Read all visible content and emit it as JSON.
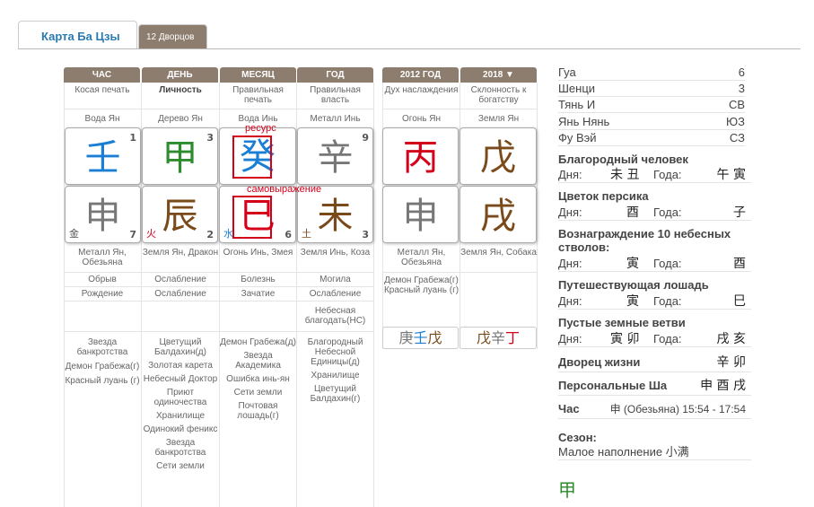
{
  "tabs": {
    "active": "Карта Ба Цзы",
    "other": "12 Дворцов"
  },
  "headers": [
    "ЧАС",
    "ДЕНЬ",
    "МЕСЯЦ",
    "ГОД",
    "2012 ГОД",
    "2018 ▼"
  ],
  "row1": [
    "Косая печать",
    "Личность",
    "Правильная печать",
    "Правильная власть",
    "Дух наслаждения",
    "Склонность к богатству"
  ],
  "row2": [
    "Вода Ян",
    "Дерево Ян",
    "Вода Инь",
    "Металл Инь",
    "Огонь Ян",
    "Земля Ян"
  ],
  "stems": [
    {
      "char": "壬",
      "color": "#1a7fd4",
      "num": "1"
    },
    {
      "char": "甲",
      "color": "#2e8b2e",
      "num": "3"
    },
    {
      "char": "癸",
      "color": "#1a7fd4",
      "num": ""
    },
    {
      "char": "辛",
      "color": "#777777",
      "num": "9"
    },
    {
      "char": "丙",
      "color": "#d4001a",
      "num": ""
    },
    {
      "char": "戊",
      "color": "#7a4a1a",
      "num": ""
    }
  ],
  "branches": [
    {
      "char": "申",
      "color": "#777777",
      "el": "金",
      "elcolor": "#555555",
      "num": "7"
    },
    {
      "char": "辰",
      "color": "#7a4a1a",
      "el": "火",
      "elcolor": "#d4001a",
      "num": "2"
    },
    {
      "char": "巳",
      "color": "#d4001a",
      "el": "水",
      "elcolor": "#1a7fd4",
      "num": "6"
    },
    {
      "char": "未",
      "color": "#7a4a1a",
      "el": "土",
      "elcolor": "#7a4a1a",
      "num": "3"
    },
    {
      "char": "申",
      "color": "#777777",
      "el": "",
      "elcolor": "#555555",
      "num": ""
    },
    {
      "char": "戌",
      "color": "#7a4a1a",
      "el": "",
      "elcolor": "#555555",
      "num": ""
    }
  ],
  "annot": {
    "resource": "ресурс",
    "self": "самовыражение"
  },
  "row3": [
    "Металл Ян, Обезьяна",
    "Земля Ян, Дракон",
    "Огонь Инь, Змея",
    "Земля Инь, Коза",
    "Металл Ян, Обезьяна",
    "Земля Ян, Собака"
  ],
  "row4": [
    "Обрыв",
    "Ослабление",
    "Болезнь",
    "Могила"
  ],
  "row5": [
    "Рождение",
    "Ослабление",
    "Зачатие",
    "Ослабление"
  ],
  "row6_year": "Небесная благодать(НС)",
  "luck_stars": "Демон Грабежа(г) Красный луань (г)",
  "hidden1": {
    "a": "庚",
    "b": "壬",
    "c": "戊"
  },
  "hidden2": {
    "a": "戊",
    "b": "辛",
    "c": "丁"
  },
  "stars_hour": [
    "Звезда банкротства",
    "Демон Грабежа(г)",
    "Красный луань (г)"
  ],
  "stars_day": [
    "Цветущий Балдахин(д)",
    "Золотая карета",
    "Небесный Доктор",
    "Приют одиночества",
    "Хранилище",
    "Одинокий феникс",
    "Звезда банкротства",
    "Сети земли"
  ],
  "stars_month": [
    "Демон Грабежа(д)",
    "Звезда Академика",
    "Ошибка инь-ян",
    "Сети земли",
    "Почтовая лошадь(г)"
  ],
  "stars_year": [
    "Благородный Небесной Единицы(д)",
    "Хранилище",
    "Цветущий Балдахин(г)"
  ],
  "right": {
    "gua_l": "Гуа",
    "gua_v": "6",
    "shenci_l": "Шенци",
    "shenci_v": "3",
    "tian_l": "Тянь И",
    "tian_v": "СВ",
    "yan_l": "Янь Нянь",
    "yan_v": "ЮЗ",
    "fu_l": "Фу Вэй",
    "fu_v": "СЗ",
    "noble": "Благородный человек",
    "noble_d": "未 丑",
    "noble_y": "午 寅",
    "peach": "Цветок персика",
    "peach_d": "酉",
    "peach_y": "子",
    "reward": "Вознаграждение 10 небесных стволов:",
    "reward_d": "寅",
    "reward_y": "酉",
    "horse": "Путешествующая лошадь",
    "horse_d": "寅",
    "horse_y": "巳",
    "empty": "Пустые земные ветви",
    "empty_d": "寅 卯",
    "empty_y": "戌 亥",
    "palace": "Дворец жизни",
    "palace_v": "辛 卯",
    "sha": "Персональные Ша",
    "sha_v": "申 酉 戌",
    "hour_l": "Час",
    "hour_v": "申 (Обезьяна) 15:54 - 17:54",
    "season_l": "Сезон:",
    "season_v": "Малое наполнение 小满",
    "bottom_char": "甲",
    "day_label": "Дня:",
    "year_label": "Года:"
  }
}
